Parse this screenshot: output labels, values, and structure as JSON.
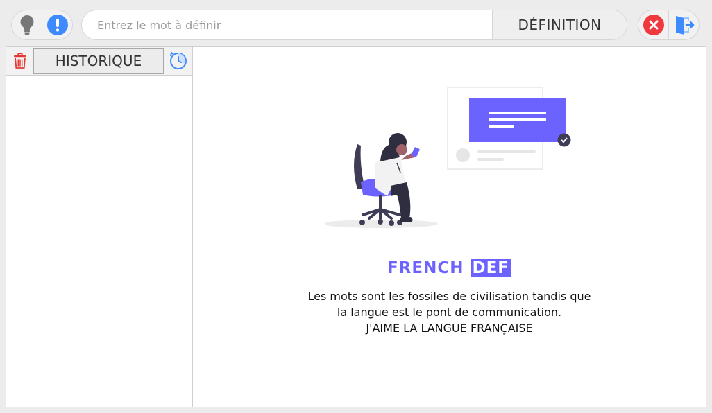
{
  "toolbar": {
    "left_icons": [
      "lightbulb-icon",
      "info-exclamation-icon"
    ],
    "search": {
      "placeholder": "Entrez le mot à définir",
      "value": ""
    },
    "definition_label": "DÉFINITION",
    "right_icons": [
      "close-icon",
      "exit-icon"
    ]
  },
  "sidebar": {
    "title": "HISTORIQUE",
    "icons": [
      "trash-icon",
      "refresh-icon"
    ],
    "items": []
  },
  "main": {
    "brand_part1": "FRENCH",
    "brand_part2": "DEF",
    "quote_line1": "Les mots sont les fossiles de civilisation tandis que",
    "quote_line2": "la langue est le pont de communication.",
    "quote_line3": "J'AIME LA LANGUE FRANÇAISE"
  },
  "colors": {
    "accent": "#6c63ff",
    "info_blue": "#3d8bff",
    "close_red": "#f0393f",
    "trash_red": "#e53935",
    "background": "#ececec"
  }
}
